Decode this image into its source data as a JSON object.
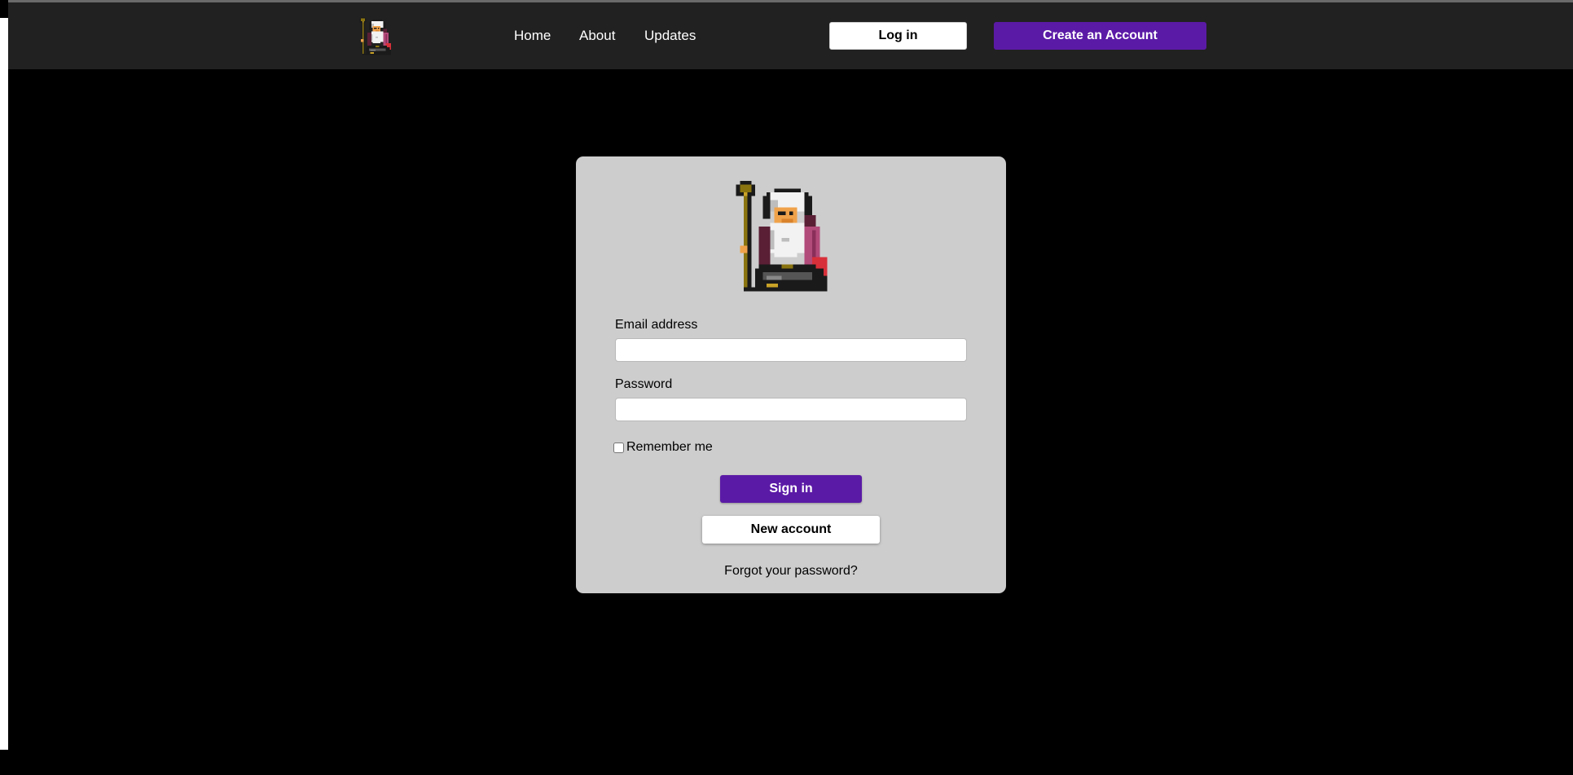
{
  "nav": {
    "links": [
      "Home",
      "About",
      "Updates"
    ],
    "login_label": "Log in",
    "create_label": "Create an Account",
    "logo_icon": "wizard-logo-icon"
  },
  "login_form": {
    "hero_icon": "wizard-sprite-icon",
    "email_label": "Email address",
    "email_value": "",
    "password_label": "Password",
    "password_value": "",
    "remember_label": "Remember me",
    "remember_checked": false,
    "signin_label": "Sign in",
    "new_account_label": "New account",
    "forgot_label": "Forgot your password?"
  },
  "colors": {
    "accent": "#5b1aa6",
    "navbar": "#212121",
    "card": "#cdcdcd",
    "page_bg": "#000000"
  }
}
